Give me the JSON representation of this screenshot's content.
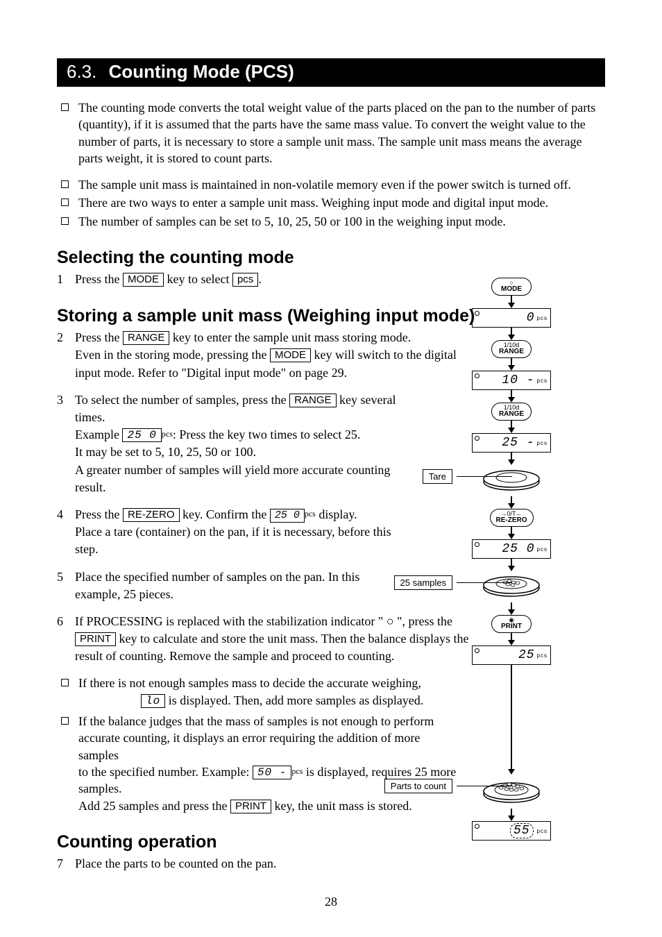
{
  "section": {
    "number": "6.3.",
    "title": "Counting Mode (PCS)"
  },
  "intro_bullets": [
    "The counting mode converts the total weight value of the parts placed on the pan to the number of parts (quantity), if it is assumed that the parts have the same mass value. To convert the weight value to the number of parts, it is necessary to store a sample unit mass. The sample unit mass means the average parts weight, it is stored to count parts.",
    "The sample unit mass is maintained in non-volatile memory even if the power switch is turned off.",
    "There are two ways to enter a sample unit mass. Weighing input mode and digital input mode.",
    "The number of samples can be set to 5, 10, 25, 50 or 100 in the weighing input mode."
  ],
  "h2a": "Selecting the counting mode",
  "step1": {
    "n": "1",
    "pre": "Press the ",
    "key1": "MODE",
    "mid": " key to select ",
    "disp1": "pcs",
    "post": "."
  },
  "h2b": "Storing a sample unit mass (Weighing input mode)",
  "step2": {
    "n": "2",
    "line1_pre": "Press the ",
    "line1_key": "RANGE",
    "line1_post": " key to enter the sample unit mass storing mode.",
    "line2_pre": "Even in the storing mode, pressing the ",
    "line2_key": "MODE",
    "line2_post": " key will switch to the digital input mode. Refer to \"Digital input mode\" on page 29."
  },
  "step3": {
    "n": "3",
    "line1": "To select the number of samples, press the ",
    "line1_key": "RANGE",
    "line1_post": " key several times.",
    "line2_pre": "Example ",
    "line2_disp": "25 0",
    "line2_sup": "pcs",
    "line2_post": ": Press the key two times to select 25.",
    "line3": "It may be set to 5, 10, 25, 50 or 100.",
    "line4": "A greater number of samples will yield more accurate counting result."
  },
  "step4": {
    "n": "4",
    "line1_pre": "Press the ",
    "line1_key": "RE-ZERO",
    "line1_mid": " key. Confirm the ",
    "line1_disp": "25  0",
    "line1_sup": "pcs",
    "line1_post": " display.",
    "line2": "Place a tare (container) on the pan, if it is necessary, before this step."
  },
  "step5": {
    "n": "5",
    "line": "Place the specified number of samples on the pan. In this example, 25 pieces."
  },
  "step6": {
    "n": "6",
    "line_pre": "If  PROCESSING  is replaced with the stabilization indicator \" ○ \", press the ",
    "line_key": "PRINT",
    "line_post": " key to calculate and store the unit mass. Then the balance displays the result of counting. Remove the sample and proceed to counting."
  },
  "note1": {
    "line1": "If there is not enough samples mass to decide the accurate weighing,",
    "line2_post": " is displayed. Then, add more samples as displayed.",
    "disp": "lo"
  },
  "note2": {
    "line1": "If the balance judges that the mass of samples is not enough to perform",
    "line2": "accurate counting, it displays an error requiring the addition of more samples",
    "line3_pre": "to the specified number. Example: ",
    "disp": "50 -",
    "sup": "pcs",
    "line3_post": " is displayed, requires 25 more samples.",
    "line4_pre": "Add 25 samples and press the ",
    "key": "PRINT",
    "line4_post": " key, the unit mass is stored."
  },
  "h2c": "Counting operation",
  "step7": {
    "n": "7",
    "line": "Place the parts to be counted on the pan."
  },
  "diagram": {
    "key_mode": {
      "top": "○",
      "bot": "MODE"
    },
    "lcd1": "0",
    "key_range": {
      "top": "1/10d",
      "bot": "RANGE"
    },
    "lcd2": "10 -",
    "lcd3": "25 -",
    "label_tare": "Tare",
    "key_rezero": {
      "top": "→0/T←",
      "bot": "RE-ZERO"
    },
    "lcd4": "25  0",
    "label_25": "25 samples",
    "key_print": {
      "top": "◉",
      "bot": "PRINT"
    },
    "lcd5": "25",
    "label_parts": "Parts to count",
    "lcd6": "55",
    "unit": "pcs"
  },
  "pagenum": "28"
}
